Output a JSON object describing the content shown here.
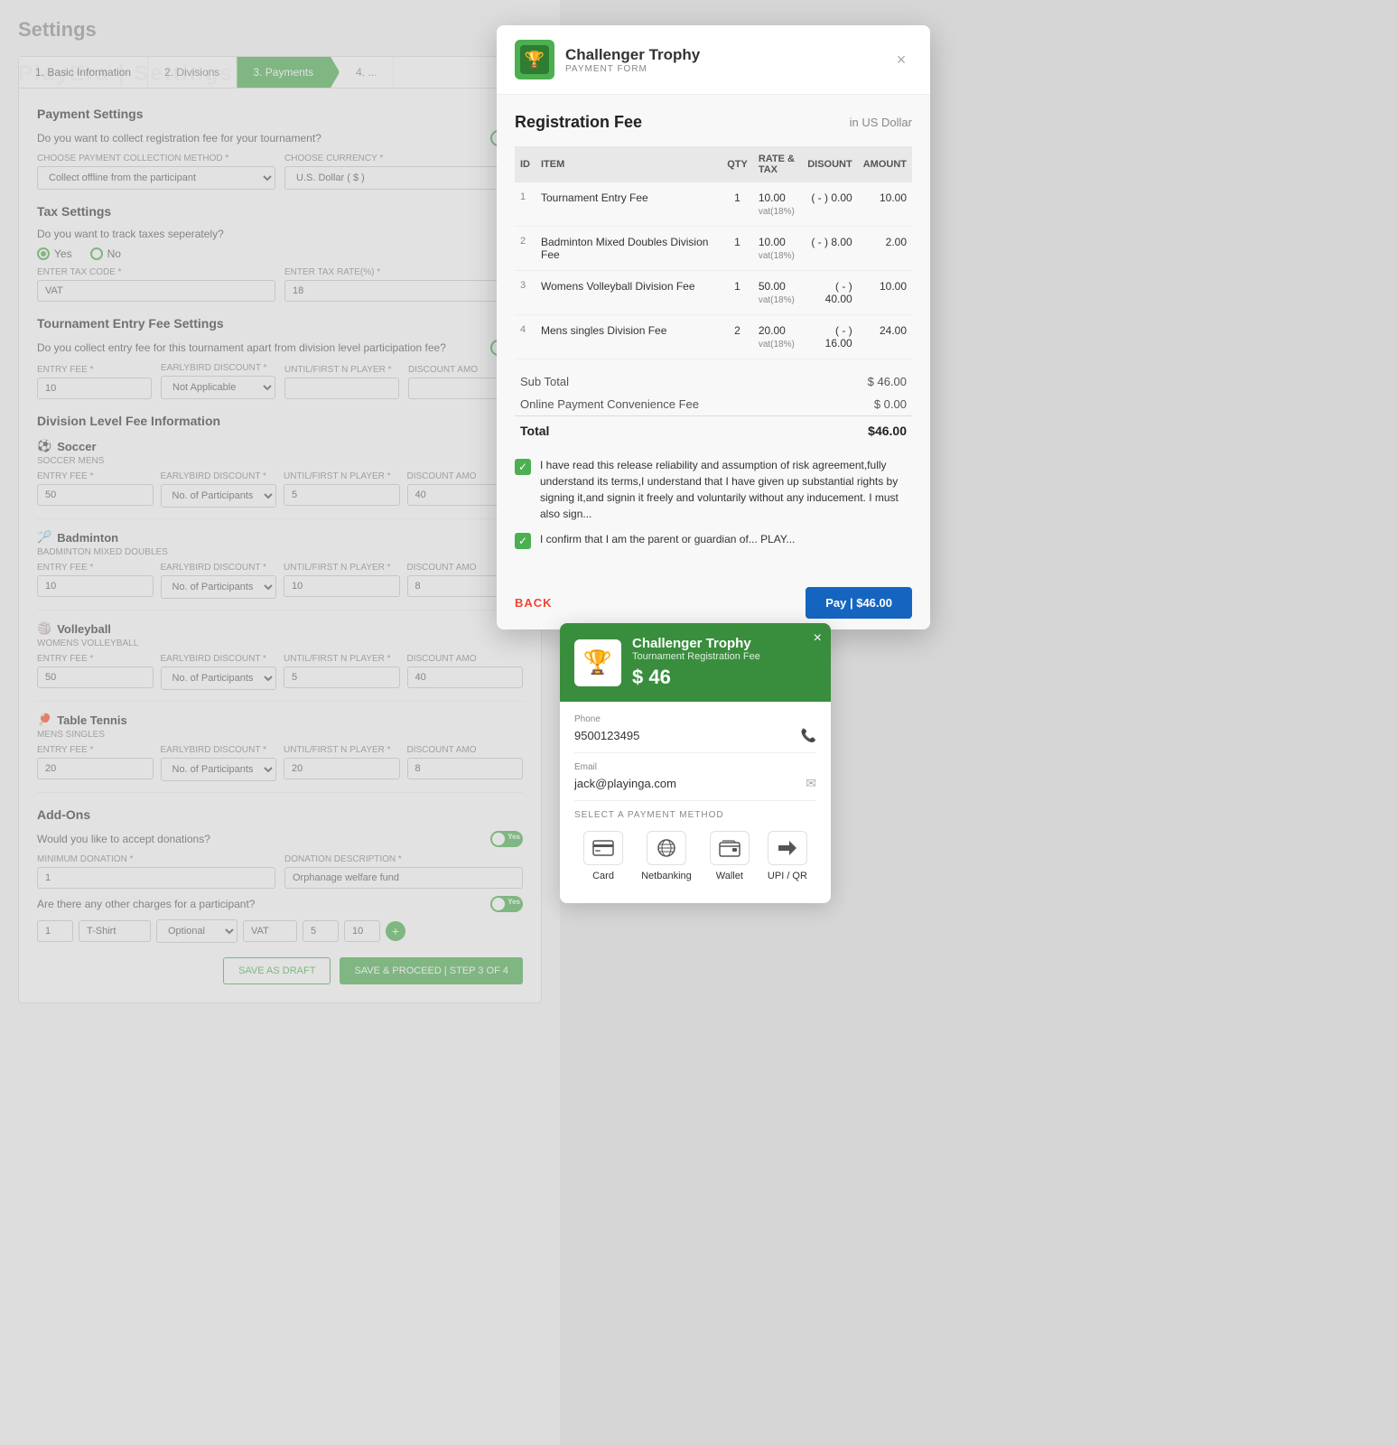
{
  "page": {
    "title": "PlayEra | Settings"
  },
  "settings": {
    "title": "Settings",
    "tabs": [
      {
        "label": "1. Basic Information",
        "active": false
      },
      {
        "label": "2. Divisions",
        "active": false
      },
      {
        "label": "3. Payments",
        "active": true
      },
      {
        "label": "4. ...",
        "active": false
      }
    ],
    "payment_settings": {
      "section": "Payment Settings",
      "question": "Do you want to collect registration fee for your tournament?",
      "toggle": "Yes",
      "collection_label": "CHOOSE PAYMENT COLLECTION METHOD *",
      "collection_value": "Collect offline from the participant",
      "currency_label": "CHOOSE CURRENCY *",
      "currency_value": "U.S. Dollar ( $ )"
    },
    "tax_settings": {
      "section": "Tax Settings",
      "question": "Do you want to track taxes seperately?",
      "yes": "Yes",
      "no": "No",
      "tax_code_label": "ENTER TAX CODE *",
      "tax_code_value": "VAT",
      "tax_rate_label": "ENTER TAX RATE(%) *",
      "tax_rate_value": "18"
    },
    "entry_fee": {
      "section": "Tournament Entry Fee Settings",
      "question": "Do you collect entry fee for this tournament apart from division level participation fee?",
      "toggle": "Yes",
      "entry_fee_label": "ENTRY FEE *",
      "entry_fee_value": "10",
      "earlybird_label": "EARLYBIRD DISCOUNT *",
      "earlybird_value": "Not Applicable",
      "until_label": "UNTIL/FIRST N PLAYER *",
      "discount_label": "DISCOUNT AMO"
    },
    "division_fee": {
      "section": "Division Level Fee Information",
      "sports": [
        {
          "name": "Soccer",
          "icon": "⚽",
          "sub": "SOCCER MENS",
          "entry_fee": "50",
          "earlybird": "No. of Participants",
          "until": "5",
          "discount": "40"
        },
        {
          "name": "Badminton",
          "icon": "🏸",
          "sub": "BADMINTON MIXED DOUBLES",
          "entry_fee": "10",
          "earlybird": "No. of Participants",
          "until": "10",
          "discount": "8"
        },
        {
          "name": "Volleyball",
          "icon": "🏐",
          "sub": "WOMENS VOLLEYBALL",
          "entry_fee": "50",
          "earlybird": "No. of Participants",
          "until": "5",
          "discount": "40"
        },
        {
          "name": "Table Tennis",
          "icon": "🏓",
          "sub": "MENS SINGLES",
          "entry_fee": "20",
          "earlybird": "No. of Participants",
          "until": "20",
          "discount": "8"
        }
      ]
    },
    "addons": {
      "section": "Add-Ons",
      "donations_q": "Would you like to accept donations?",
      "donations_toggle": "Yes",
      "min_donation_label": "MINIMUM DONATION *",
      "min_donation_value": "1",
      "donation_desc_label": "DONATION DESCRIPTION *",
      "donation_desc_value": "Orphanage welfare fund",
      "other_charges_q": "Are there any other charges for a participant?",
      "other_charges_toggle": "Yes",
      "charge_qty": "1",
      "charge_name": "T-Shirt",
      "charge_type": "Optional",
      "charge_tax": "VAT",
      "charge_amount": "5",
      "charge_discount": "10"
    },
    "buttons": {
      "save_draft": "SAVE AS DRAFT",
      "proceed": "SAVE & PROCEED | STEP 3 OF 4"
    }
  },
  "payment_modal": {
    "title": "Challenger Trophy",
    "subtitle": "PAYMENT FORM",
    "close": "×",
    "reg_fee_title": "Registration Fee",
    "currency": "in US Dollar",
    "table": {
      "headers": [
        "ID",
        "ITEM",
        "QTY",
        "RATE & TAX",
        "DISOUNT",
        "AMOUNT"
      ],
      "rows": [
        {
          "id": "1",
          "item": "Tournament Entry Fee",
          "qty": "1",
          "rate": "10.00",
          "tax": "vat(18%)",
          "discount": "( - ) 0.00",
          "amount": "10.00"
        },
        {
          "id": "2",
          "item": "Badminton Mixed Doubles Division Fee",
          "qty": "1",
          "rate": "10.00",
          "tax": "vat(18%)",
          "discount": "( - ) 8.00",
          "amount": "2.00"
        },
        {
          "id": "3",
          "item": "Womens Volleyball Division Fee",
          "qty": "1",
          "rate": "50.00",
          "tax": "vat(18%)",
          "discount": "( - ) 40.00",
          "amount": "10.00"
        },
        {
          "id": "4",
          "item": "Mens singles Division Fee",
          "qty": "2",
          "rate": "20.00",
          "tax": "vat(18%)",
          "discount": "( - ) 16.00",
          "amount": "24.00"
        }
      ]
    },
    "subtotal_label": "Sub Total",
    "subtotal_value": "$ 46.00",
    "convenience_label": "Online Payment Convenience Fee",
    "convenience_value": "$ 0.00",
    "total_label": "Total",
    "total_value": "$46.00",
    "agreement1": "I have read this release reliability and assumption of risk agreement,fully understand its terms,I understand that I have given up substantial rights by signing it,and signin it freely and voluntarily without any inducement. I must also sign...",
    "agreement2": "I confirm that I am the parent or guardian of... PLAY...",
    "back_label": "BACK",
    "pay_label": "Pay | $46.00"
  },
  "payment_widget": {
    "name": "Challenger Trophy",
    "sub": "Tournament Registration Fee",
    "amount": "$ 46",
    "close": "×",
    "logo_icon": "🏆",
    "phone_label": "Phone",
    "phone_value": "9500123495",
    "phone_icon": "📞",
    "email_label": "Email",
    "email_value": "jack@playinga.com",
    "email_icon": "✉",
    "select_method": "SELECT A PAYMENT METHOD",
    "methods": [
      {
        "id": "card",
        "label": "Card",
        "icon": "💳",
        "selected": false
      },
      {
        "id": "netbanking",
        "label": "Netbanking",
        "icon": "🌐",
        "selected": false
      },
      {
        "id": "wallet",
        "label": "Wallet",
        "icon": "👛",
        "selected": false
      },
      {
        "id": "upi",
        "label": "UPI / QR",
        "icon": "➤",
        "selected": false
      }
    ]
  }
}
